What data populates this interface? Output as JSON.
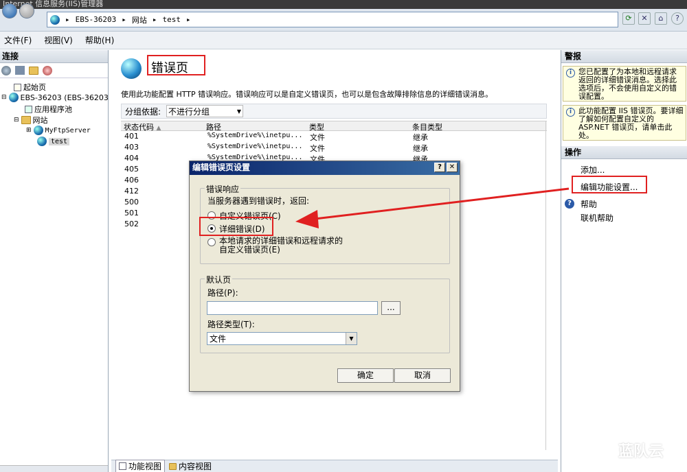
{
  "window": {
    "title": "Internet 信息服务(IIS)管理器"
  },
  "address": {
    "segments": [
      "EBS-36203",
      "网站",
      "test"
    ]
  },
  "menu": [
    "文件(F)",
    "视图(V)",
    "帮助(H)"
  ],
  "left": {
    "header": "连接",
    "tree": [
      {
        "label": "起始页"
      },
      {
        "label": "EBS-36203 (EBS-36203"
      },
      {
        "label": "应用程序池"
      },
      {
        "label": "网站"
      },
      {
        "label": "MyFtpServer"
      },
      {
        "label": "test"
      }
    ]
  },
  "center": {
    "title": "错误页",
    "description": "使用此功能配置 HTTP 错误响应。错误响应可以是自定义错误页，也可以是包含故障排除信息的详细错误消息。",
    "group_label": "分组依据:",
    "group_value": "不进行分组",
    "columns": [
      "状态代码",
      "路径",
      "类型",
      "条目类型"
    ],
    "rows": [
      {
        "code": "401",
        "path": "%SystemDrive%\\inetpu...",
        "type": "文件",
        "entry": "继承"
      },
      {
        "code": "403",
        "path": "%SystemDrive%\\inetpu...",
        "type": "文件",
        "entry": "继承"
      },
      {
        "code": "404",
        "path": "%SystemDrive%\\inetpu...",
        "type": "文件",
        "entry": "继承"
      },
      {
        "code": "405"
      },
      {
        "code": "406"
      },
      {
        "code": "412"
      },
      {
        "code": "500"
      },
      {
        "code": "501"
      },
      {
        "code": "502"
      }
    ]
  },
  "right": {
    "alerts_header": "警报",
    "alert1": "您已配置了为本地和远程请求返回的详细错误消息。选择此选项后，不会使用自定义的错误配置。",
    "alert2": "此功能配置 IIS 错误页。要详细了解如何配置自定义的 ASP.NET 错误页，请单击此处。",
    "actions_header": "操作",
    "add": "添加...",
    "edit": "编辑功能设置...",
    "help": "帮助",
    "online_help": "联机帮助"
  },
  "dialog": {
    "title": "编辑错误页设置",
    "group1": "错误响应",
    "prompt": "当服务器遇到错误时，返回:",
    "opt1": "自定义错误页(C)",
    "opt2": "详细错误(D)",
    "opt3_line1": "本地请求的详细错误和远程请求的",
    "opt3_line2": "自定义错误页(E)",
    "group2": "默认页",
    "path_label": "路径(P):",
    "path_value": "",
    "browse": "...",
    "path_type_label": "路径类型(T):",
    "path_type_value": "文件",
    "ok": "确定",
    "cancel": "取消"
  },
  "bottom": {
    "features_view": "功能视图",
    "content_view": "内容视图"
  },
  "watermark": "蓝队云",
  "colors": {
    "annotation": "#e02020",
    "dialog_title": "#0a246a"
  }
}
